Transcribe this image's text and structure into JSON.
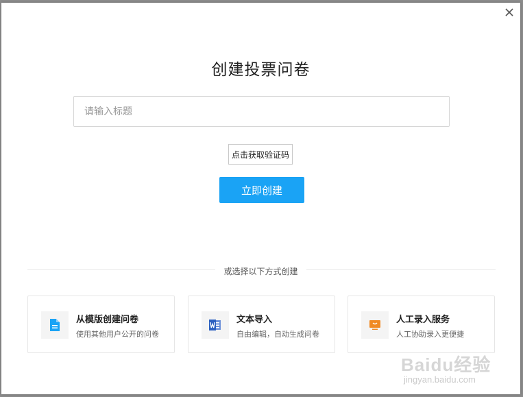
{
  "dialog": {
    "title": "创建投票问卷",
    "title_input": {
      "placeholder": "请输入标题",
      "value": ""
    },
    "captcha_label": "点击获取验证码",
    "create_label": "立即创建",
    "divider_label": "或选择以下方式创建"
  },
  "options": [
    {
      "title": "从模版创建问卷",
      "desc": "使用其他用户公开的问卷",
      "icon": "document-icon",
      "color": "#1aa3f5"
    },
    {
      "title": "文本导入",
      "desc": "自由编辑，自动生成问卷",
      "icon": "word-doc-icon",
      "color": "#2b5fc0"
    },
    {
      "title": "人工录入服务",
      "desc": "人工协助录入更便捷",
      "icon": "monitor-icon",
      "color": "#f08a24"
    }
  ],
  "watermark": {
    "logo": "Baidu经验",
    "url": "jingyan.baidu.com"
  }
}
